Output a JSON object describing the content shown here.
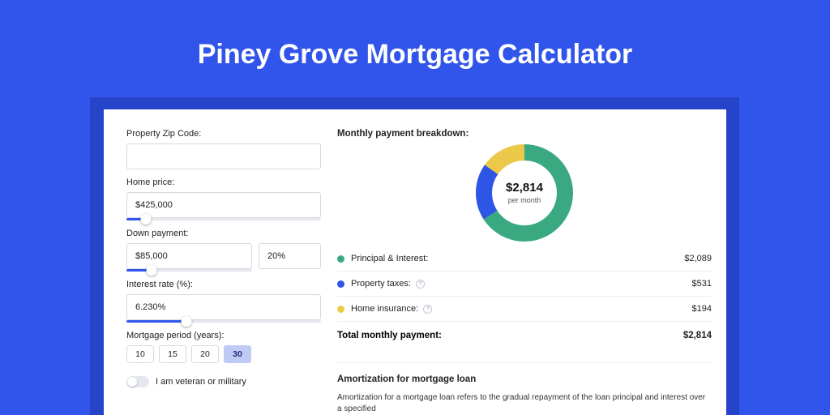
{
  "title": "Piney Grove Mortgage Calculator",
  "form": {
    "zip_label": "Property Zip Code:",
    "zip_value": "",
    "home_price_label": "Home price:",
    "home_price_value": "$425,000",
    "home_price_slider_pct": 10,
    "down_payment_label": "Down payment:",
    "down_payment_value": "$85,000",
    "down_payment_pct_value": "20%",
    "down_payment_slider_pct": 20,
    "interest_label": "Interest rate (%):",
    "interest_value": "6.230%",
    "interest_slider_pct": 31,
    "term_label": "Mortgage period (years):",
    "term_options": [
      "10",
      "15",
      "20",
      "30"
    ],
    "term_selected_index": 3,
    "veteran_label": "I am veteran or military",
    "veteran_on": false
  },
  "breakdown": {
    "title": "Monthly payment breakdown:",
    "donut_value": "$2,814",
    "donut_sub": "per month",
    "items": [
      {
        "color": "g",
        "label": "Principal & Interest:",
        "info": false,
        "value": "$2,089"
      },
      {
        "color": "b",
        "label": "Property taxes:",
        "info": true,
        "value": "$531"
      },
      {
        "color": "y",
        "label": "Home insurance:",
        "info": true,
        "value": "$194"
      }
    ],
    "total_label": "Total monthly payment:",
    "total_value": "$2,814"
  },
  "amort": {
    "title": "Amortization for mortgage loan",
    "text": "Amortization for a mortgage loan refers to the gradual repayment of the loan principal and interest over a specified"
  },
  "chart_data": {
    "type": "pie",
    "title": "Monthly payment breakdown",
    "series": [
      {
        "name": "Principal & Interest",
        "value": 2089,
        "color": "#3aa981"
      },
      {
        "name": "Property taxes",
        "value": 531,
        "color": "#2f55e6"
      },
      {
        "name": "Home insurance",
        "value": 194,
        "color": "#ecc94b"
      }
    ],
    "total": 2814,
    "center_label": "$2,814",
    "center_sublabel": "per month",
    "donut": true,
    "start_angle_deg": -30
  }
}
